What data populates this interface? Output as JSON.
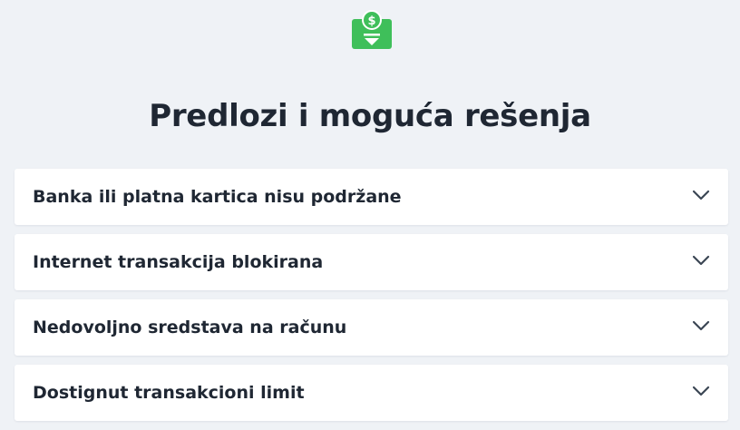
{
  "header": {
    "icon": "money-download-icon",
    "icon_color": "#3fbf5a",
    "title": "Predlozi i moguća rešenja"
  },
  "faq": {
    "items": [
      {
        "label": "Banka ili platna kartica nisu podržane",
        "expanded": false
      },
      {
        "label": "Internet transakcija blokirana",
        "expanded": false
      },
      {
        "label": "Nedovoljno sredstava na računu",
        "expanded": false
      },
      {
        "label": "Dostignut transakcioni limit",
        "expanded": false
      }
    ],
    "chevron_icon": "chevron-down-icon"
  }
}
